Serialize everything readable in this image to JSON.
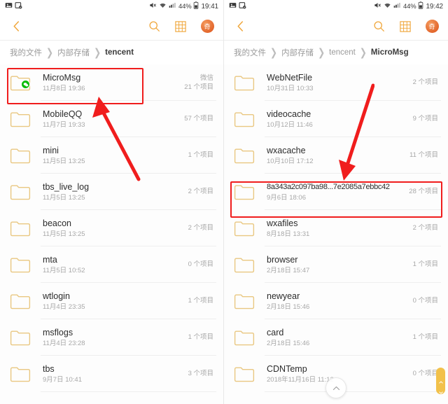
{
  "colors": {
    "accent": "#f0a73c",
    "highlight": "#f01d1d",
    "folder": "#e9c781",
    "wechat_green": "#09bb07",
    "scrollbar": "#f2c14a",
    "text_primary": "#2b2b2b",
    "text_secondary": "#a8a8a8"
  },
  "panels": [
    {
      "id": "left",
      "statusbar": {
        "left_icons": [
          "screenshot-icon",
          "image-saved-icon"
        ],
        "right_icons": [
          "mute-icon",
          "wifi-icon",
          "signal-icon"
        ],
        "battery_percent": "44%",
        "battery_icon": "battery-icon",
        "time": "19:41"
      },
      "toolbar": {
        "back_icon": "back-chevron-icon",
        "search_icon": "search-icon",
        "grid_icon": "grid-view-icon",
        "badge_icon": "app-badge-icon",
        "badge_label": "奇"
      },
      "breadcrumb": [
        {
          "label": "我的文件",
          "active": false
        },
        {
          "label": "内部存储",
          "active": false
        },
        {
          "label": "tencent",
          "active": true
        }
      ],
      "files": [
        {
          "name": "MicroMsg",
          "date": "11月8日 19:36",
          "tag": "微信",
          "count": "21 个项目",
          "badge": "wechat-badge",
          "highlighted": true
        },
        {
          "name": "MobileQQ",
          "date": "11月7日 19:33",
          "tag": "",
          "count": "57 个项目",
          "badge": null,
          "highlighted": false
        },
        {
          "name": "mini",
          "date": "11月5日 13:25",
          "tag": "",
          "count": "1 个项目",
          "badge": null,
          "highlighted": false
        },
        {
          "name": "tbs_live_log",
          "date": "11月5日 13:25",
          "tag": "",
          "count": "2 个项目",
          "badge": null,
          "highlighted": false
        },
        {
          "name": "beacon",
          "date": "11月5日 13:25",
          "tag": "",
          "count": "2 个项目",
          "badge": null,
          "highlighted": false
        },
        {
          "name": "mta",
          "date": "11月5日 10:52",
          "tag": "",
          "count": "0 个项目",
          "badge": null,
          "highlighted": false
        },
        {
          "name": "wtlogin",
          "date": "11月4日 23:35",
          "tag": "",
          "count": "1 个项目",
          "badge": null,
          "highlighted": false
        },
        {
          "name": "msflogs",
          "date": "11月4日 23:28",
          "tag": "",
          "count": "1 个项目",
          "badge": null,
          "highlighted": false
        },
        {
          "name": "tbs",
          "date": "9月7日 10:41",
          "tag": "",
          "count": "3 个项目",
          "badge": null,
          "highlighted": false
        }
      ],
      "annotation_arrow": true,
      "fab": null,
      "scrollbar": false,
      "watermark": ""
    },
    {
      "id": "right",
      "statusbar": {
        "left_icons": [
          "screenshot-icon",
          "image-saved-icon"
        ],
        "right_icons": [
          "mute-icon",
          "wifi-icon",
          "signal-icon"
        ],
        "battery_percent": "44%",
        "battery_icon": "battery-icon",
        "time": "19:42"
      },
      "toolbar": {
        "back_icon": "back-chevron-icon",
        "search_icon": "search-icon",
        "grid_icon": "grid-view-icon",
        "badge_icon": "app-badge-icon",
        "badge_label": "奇"
      },
      "breadcrumb": [
        {
          "label": "我的文件",
          "active": false
        },
        {
          "label": "内部存储",
          "active": false
        },
        {
          "label": "tencent",
          "active": false
        },
        {
          "label": "MicroMsg",
          "active": true
        }
      ],
      "files": [
        {
          "name": "WebNetFile",
          "date": "10月31日 10:33",
          "tag": "",
          "count": "2 个项目",
          "badge": null,
          "highlighted": false,
          "tight": false
        },
        {
          "name": "videocache",
          "date": "10月12日 11:46",
          "tag": "",
          "count": "9 个项目",
          "badge": null,
          "highlighted": false,
          "tight": false
        },
        {
          "name": "wxacache",
          "date": "10月10日 17:12",
          "tag": "",
          "count": "11 个项目",
          "badge": null,
          "highlighted": false,
          "tight": false
        },
        {
          "name": "8a343a2c097ba98...7e2085a7ebbc42",
          "date": "9月6日 18:06",
          "tag": "",
          "count": "28 个项目",
          "badge": null,
          "highlighted": true,
          "tight": true
        },
        {
          "name": "wxafiles",
          "date": "8月18日 13:31",
          "tag": "",
          "count": "2 个项目",
          "badge": null,
          "highlighted": false,
          "tight": false
        },
        {
          "name": "browser",
          "date": "2月18日 15:47",
          "tag": "",
          "count": "1 个项目",
          "badge": null,
          "highlighted": false,
          "tight": false
        },
        {
          "name": "newyear",
          "date": "2月18日 15:46",
          "tag": "",
          "count": "0 个项目",
          "badge": null,
          "highlighted": false,
          "tight": false
        },
        {
          "name": "card",
          "date": "2月18日 15:46",
          "tag": "",
          "count": "1 个项目",
          "badge": null,
          "highlighted": false,
          "tight": false
        },
        {
          "name": "CDNTemp",
          "date": "2018年11月16日 11:12",
          "tag": "",
          "count": "0 个项目",
          "badge": null,
          "highlighted": false,
          "tight": false
        }
      ],
      "annotation_arrow": true,
      "fab": {
        "icon": "scroll-to-top-icon"
      },
      "scrollbar": true,
      "watermark": ""
    }
  ]
}
